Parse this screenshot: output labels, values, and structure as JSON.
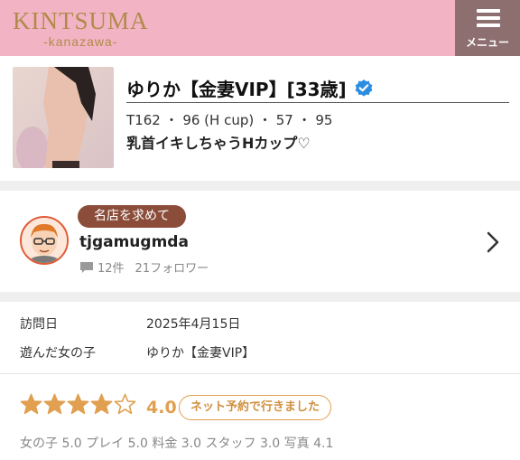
{
  "header": {
    "logo_main": "KINTSUMA",
    "logo_sub": "-kanazawa-",
    "menu_label": "メニュー"
  },
  "profile": {
    "name": "ゆりか【金妻VIP】[33歳]",
    "stats": "T162 ・ 96 (H cup) ・ 57 ・ 95",
    "catch": "乳首イキしちゃうHカップ♡"
  },
  "reviewer": {
    "badge": "名店を求めて",
    "username": "tjgamugmda",
    "review_count": "12件",
    "followers": "21フォロワー"
  },
  "visit": {
    "date_label": "訪問日",
    "date_value": "2025年4月15日",
    "girl_label": "遊んだ女の子",
    "girl_value": "ゆりか【金妻VIP】"
  },
  "rating": {
    "stars_filled": 4,
    "stars_total": 5,
    "score": "4.0",
    "booking_badge": "ネット予約で行きました",
    "subscores": "女の子 5.0 プレイ 5.0 料金 3.0 スタッフ 3.0 写真 4.1"
  },
  "colors": {
    "header_bg": "#f2b4c4",
    "menu_bg": "#8e6f70",
    "logo": "#b08a4a",
    "star": "#e0a050",
    "badge_bg": "#8b4d3a",
    "verified": "#2a8de0"
  }
}
